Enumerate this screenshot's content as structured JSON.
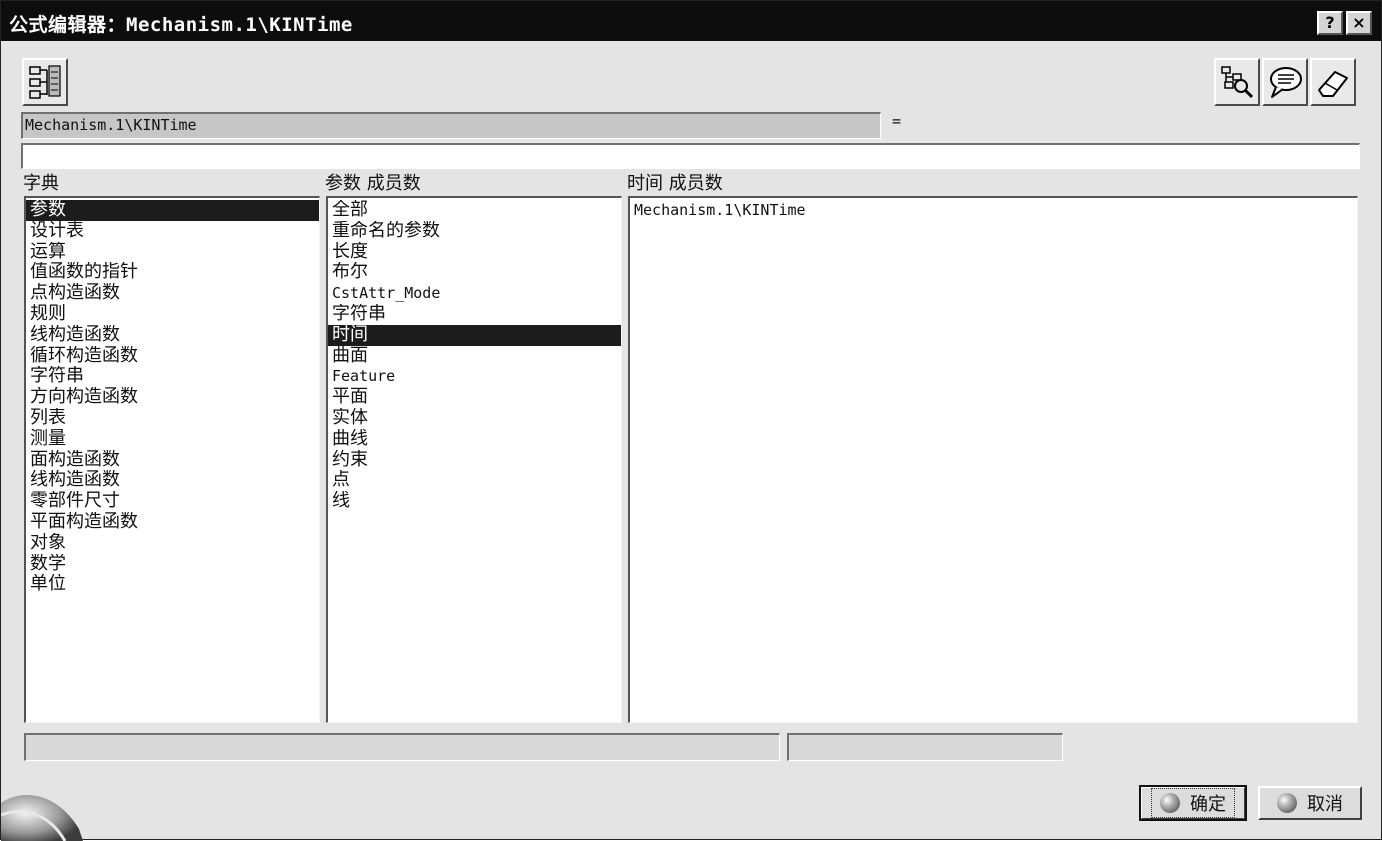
{
  "window": {
    "title": "公式编辑器：Mechanism.1\\KINTime",
    "help_label": "?",
    "close_label": "×"
  },
  "toolbar": {
    "left_icon": "dictionary-tree-icon",
    "right_icons": [
      "search-tree-icon",
      "speech-bubble-icon",
      "eraser-icon"
    ]
  },
  "parameter": {
    "name": "Mechanism.1\\KINTime",
    "equals": "="
  },
  "formula": {
    "value": ""
  },
  "dictionary": {
    "label": "字典",
    "items": [
      "参数",
      "设计表",
      "运算",
      "值函数的指针",
      "点构造函数",
      "规则",
      "线构造函数",
      "循环构造函数",
      "字符串",
      "方向构造函数",
      "列表",
      "测量",
      "面构造函数",
      "线构造函数",
      "零部件尺寸",
      "平面构造函数",
      "对象",
      "数学",
      "单位"
    ],
    "selected_index": 0
  },
  "members": {
    "label": "参数 成员数",
    "items": [
      "全部",
      "重命名的参数",
      "长度",
      "布尔",
      "CstAttr_Mode",
      "字符串",
      "时间",
      "曲面",
      "Feature",
      "平面",
      "实体",
      "曲线",
      "约束",
      "点",
      "线"
    ],
    "selected_index": 6
  },
  "values": {
    "label": "时间 成员数",
    "items": [
      "Mechanism.1\\KINTime"
    ]
  },
  "buttons": {
    "ok_label": "确定",
    "cancel_label": "取消"
  },
  "colors": {
    "titlebar": "#0d0d0d",
    "selection": "#1c1c1c",
    "window_bg": "#e4e4e4"
  }
}
